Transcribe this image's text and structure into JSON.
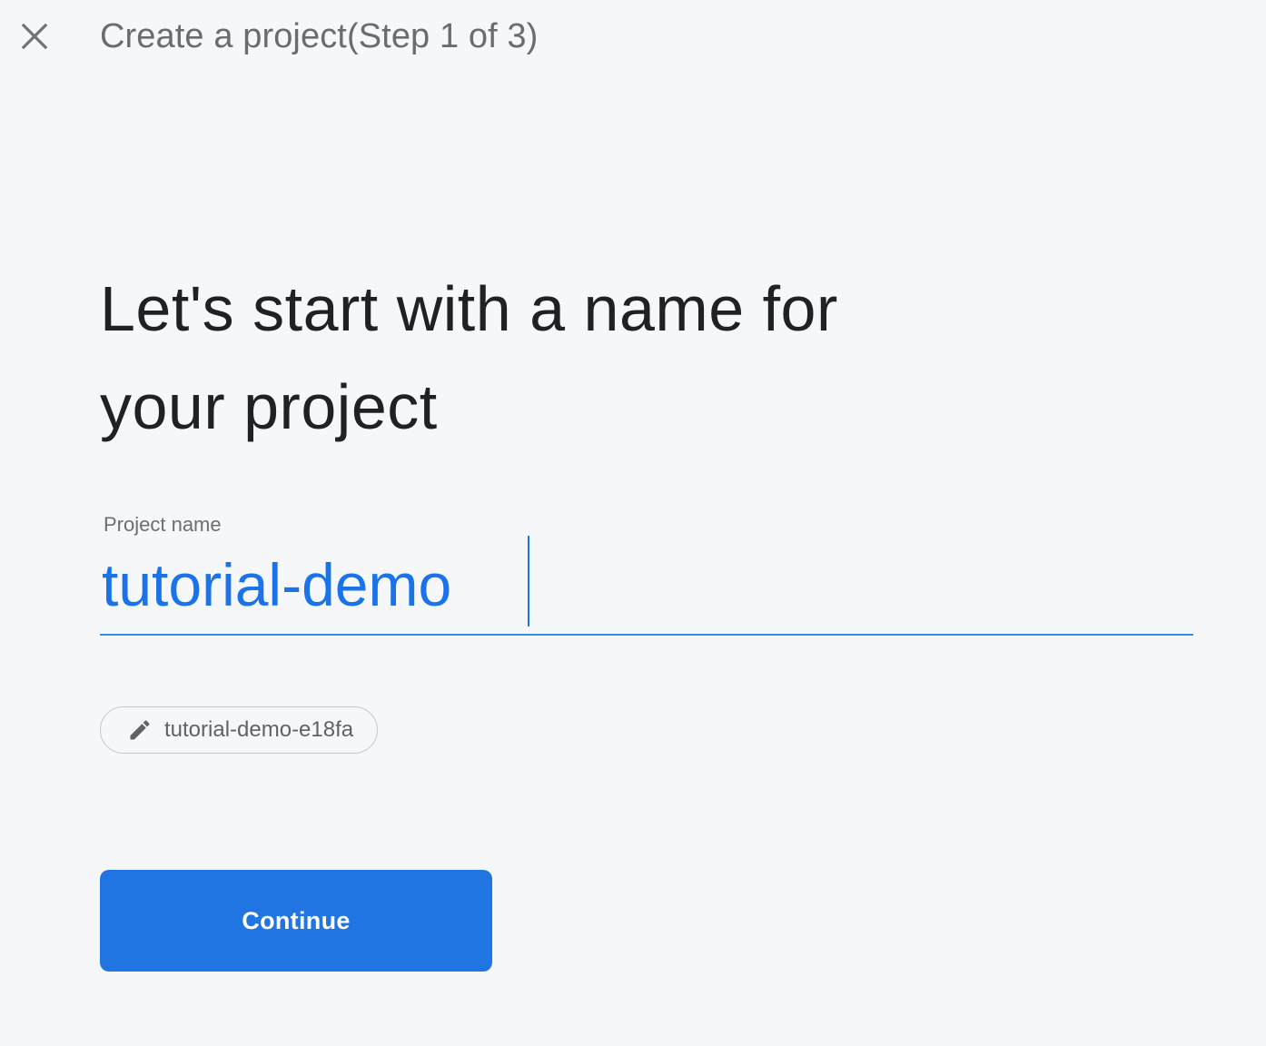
{
  "header": {
    "close_icon": "close-icon",
    "title": "Create a project(Step 1 of 3)"
  },
  "main": {
    "heading_line1": "Let's start with a name for",
    "heading_line2": "your project",
    "project_name": {
      "label": "Project name",
      "value": "tutorial-demo"
    },
    "project_id_chip": {
      "icon": "pencil-icon",
      "value": "tutorial-demo-e18fa"
    },
    "continue_label": "Continue"
  },
  "colors": {
    "background": "#f6f7f9",
    "accent": "#1a73e8",
    "button": "#2175e3",
    "muted_text": "#6a6d70"
  }
}
